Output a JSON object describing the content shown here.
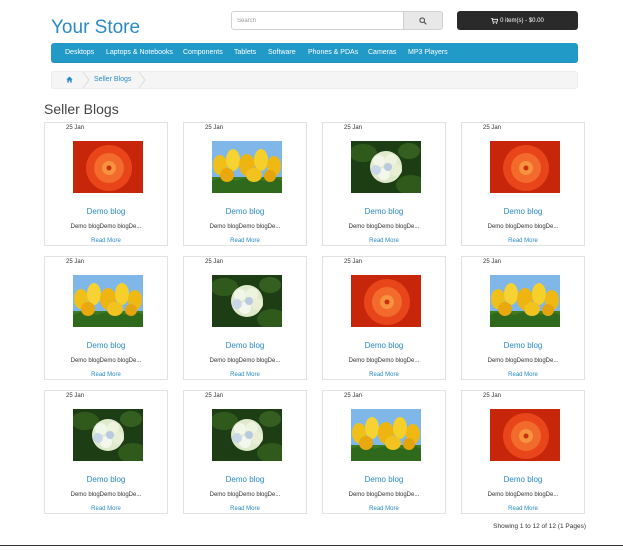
{
  "header": {
    "store_name": "Your Store",
    "search": {
      "placeholder": "Search",
      "button_icon": "search-icon"
    },
    "cart": {
      "label": "0 item(s) - $0.00",
      "icon": "cart-icon"
    }
  },
  "menu": {
    "items": [
      {
        "label": "Desktops"
      },
      {
        "label": "Laptops & Notebooks"
      },
      {
        "label": "Components"
      },
      {
        "label": "Tablets"
      },
      {
        "label": "Software"
      },
      {
        "label": "Phones & PDAs"
      },
      {
        "label": "Cameras"
      },
      {
        "label": "MP3 Players"
      }
    ]
  },
  "breadcrumb": {
    "home_icon": "home-icon",
    "current": "Seller Blogs"
  },
  "page": {
    "title": "Seller Blogs"
  },
  "blogs": [
    {
      "date": "25 Jan",
      "image": "red-dahlia",
      "title": "Demo blog",
      "excerpt": "Demo blogDemo blogDe...",
      "read_more": "Read More"
    },
    {
      "date": "25 Jan",
      "image": "yellow-tulips",
      "title": "Demo blog",
      "excerpt": "Demo blogDemo blogDe...",
      "read_more": "Read More"
    },
    {
      "date": "25 Jan",
      "image": "white-hydrangea",
      "title": "Demo blog",
      "excerpt": "Demo blogDemo blogDe...",
      "read_more": "Read More"
    },
    {
      "date": "25 Jan",
      "image": "red-dahlia",
      "title": "Demo blog",
      "excerpt": "Demo blogDemo blogDe...",
      "read_more": "Read More"
    },
    {
      "date": "25 Jan",
      "image": "yellow-tulips",
      "title": "Demo blog",
      "excerpt": "Demo blogDemo blogDe...",
      "read_more": "Read More"
    },
    {
      "date": "25 Jan",
      "image": "white-hydrangea",
      "title": "Demo blog",
      "excerpt": "Demo blogDemo blogDe...",
      "read_more": "Read More"
    },
    {
      "date": "25 Jan",
      "image": "red-dahlia",
      "title": "Demo blog",
      "excerpt": "Demo blogDemo blogDe...",
      "read_more": "Read More"
    },
    {
      "date": "25 Jan",
      "image": "yellow-tulips",
      "title": "Demo blog",
      "excerpt": "Demo blogDemo blogDe...",
      "read_more": "Read More"
    },
    {
      "date": "25 Jan",
      "image": "white-hydrangea",
      "title": "Demo blog",
      "excerpt": "Demo blogDemo blogDe...",
      "read_more": "Read More"
    },
    {
      "date": "25 Jan",
      "image": "white-hydrangea",
      "title": "Demo blog",
      "excerpt": "Demo blogDemo blogDe...",
      "read_more": "Read More"
    },
    {
      "date": "25 Jan",
      "image": "yellow-tulips",
      "title": "Demo blog",
      "excerpt": "Demo blogDemo blogDe...",
      "read_more": "Read More"
    },
    {
      "date": "25 Jan",
      "image": "red-dahlia",
      "title": "Demo blog",
      "excerpt": "Demo blogDemo blogDe...",
      "read_more": "Read More"
    }
  ],
  "pagination": {
    "summary": "Showing 1 to 12 of 12 (1 Pages)"
  },
  "colors": {
    "brand": "#2a8ac4",
    "menu": "#229ac8",
    "cart": "#2a2a2a"
  }
}
